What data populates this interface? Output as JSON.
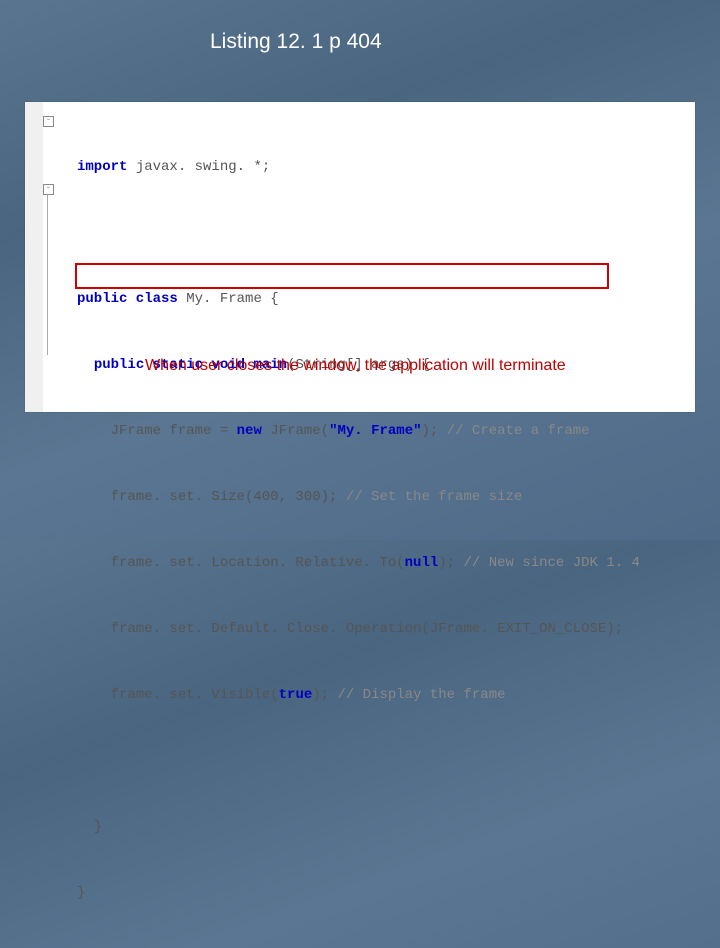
{
  "title": "Listing 12. 1 p 404",
  "code": {
    "line1_kw": "import",
    "line1_rest": " javax. swing. *;",
    "line2_kw1": "public class",
    "line2_name": " My. Frame {",
    "line3_pre": "  ",
    "line3_kw": "public static void",
    "line3_name": " main",
    "line3_rest": "(String[] args) {",
    "line4_pre": "    JFrame frame = ",
    "line4_kw": "new",
    "line4_mid": " JFrame(",
    "line4_str": "\"My. Frame\"",
    "line4_rest": "); ",
    "line4_comment": "// Create a frame",
    "line5_pre": "    frame. set. Size(400, 300); ",
    "line5_comment": "// Set the frame size",
    "line6_pre": "    frame. set. Location. Relative. To(",
    "line6_kw": "null",
    "line6_rest": "); ",
    "line6_comment": "// New since JDK 1. 4",
    "line7_pre": "    frame. set. Default. Close. Operation(JFrame. EXIT_ON_CLOSE);",
    "line8_pre": "    frame. set. Visible(",
    "line8_kw": "true",
    "line8_rest": "); ",
    "line8_comment": "// Display the frame",
    "line9": "  }",
    "line10": "}"
  },
  "caption": "When user closes the window, the application will terminate"
}
